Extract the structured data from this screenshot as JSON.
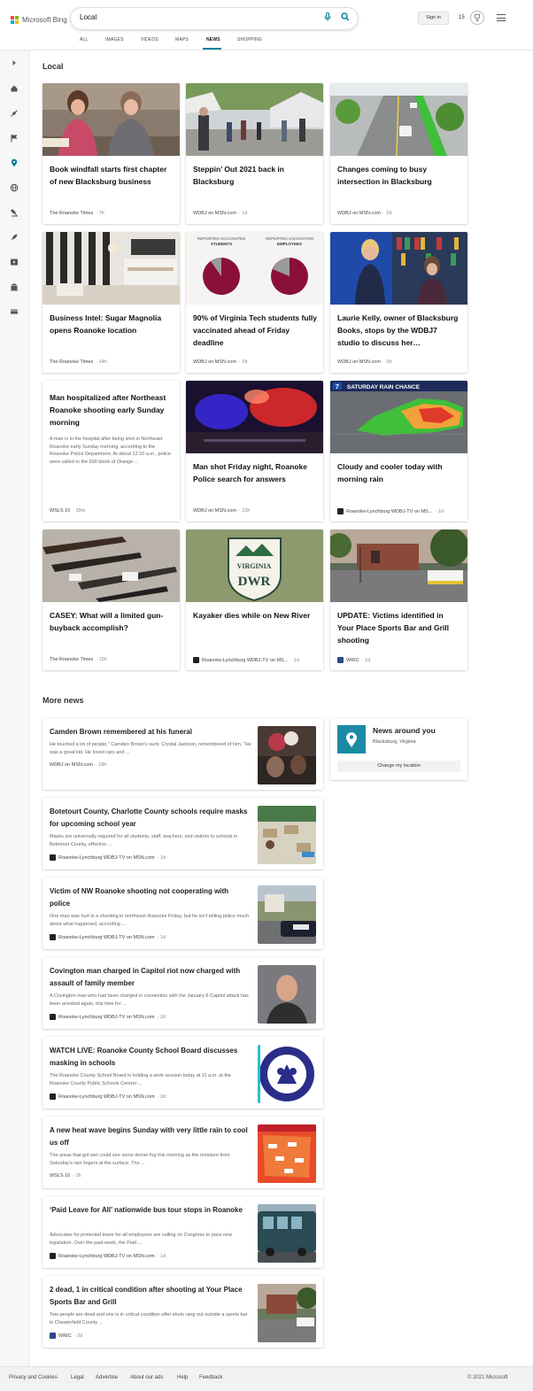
{
  "app": {
    "brand": "Microsoft Bing"
  },
  "search": {
    "query": "Local"
  },
  "header": {
    "signin_label": "Sign in",
    "rewards_count": "15"
  },
  "tabs": [
    {
      "label": "ALL"
    },
    {
      "label": "IMAGES"
    },
    {
      "label": "VIDEOS"
    },
    {
      "label": "MAPS"
    },
    {
      "label": "NEWS"
    },
    {
      "label": "SHOPPING"
    }
  ],
  "active_tab": "NEWS",
  "accent_color": "#00809d",
  "rail_icons": [
    "expand-chevron-icon",
    "home-icon",
    "satellite-icon",
    "flag-icon",
    "location-pin-icon",
    "globe-icon",
    "science-icon",
    "rocket-icon",
    "video-icon",
    "bank-icon",
    "money-icon"
  ],
  "local": {
    "title": "Local",
    "cards": [
      {
        "title": "Book windfall starts first chapter of new Blacksburg business",
        "source": "The Roanoke Times",
        "age": "7h"
      },
      {
        "title": "Steppin’ Out 2021 back in Blacksburg",
        "source": "WDBJ on MSN.com",
        "age": "1d"
      },
      {
        "title": "Changes coming to busy intersection in Blacksburg",
        "source": "WDBJ on MSN.com",
        "age": "2d"
      },
      {
        "title": "Business Intel: Sugar Magnolia opens Roanoke location",
        "source": "The Roanoke Times",
        "age": "14h"
      },
      {
        "title": "90% of Virginia Tech students fully vaccinated ahead of Friday deadline",
        "source": "WDBJ on MSN.com",
        "age": "2d",
        "image_labels": [
          "REPORTED VACCINATED STUDENTS",
          "REPORTED VACCINATED EMPLOYEES"
        ]
      },
      {
        "title": "Laurie Kelly, owner of Blacksburg Books, stops by the WDBJ7 studio to discuss her…",
        "source": "WDBJ on MSN.com",
        "age": "3d"
      },
      {
        "title": "Man hospitalized after Northeast Roanoke shooting early Sunday morning",
        "snippet": "A man is in the hospital after being shot in Northeast Roanoke early Sunday morning, according to the Roanoke Police Department. At about 12:10 a.m., police were called to the 600 block of Orange ...",
        "source": "WSLS 10",
        "age": "39m"
      },
      {
        "title": "Man shot Friday night, Roanoke Police search for answers",
        "source": "WDBJ on MSN.com",
        "age": "22h"
      },
      {
        "title": "Cloudy and cooler today with morning rain",
        "source": "Roanoke-Lynchburg WDBJ-TV on MS...",
        "age": "1d",
        "image_labels": [
          "7",
          "SATURDAY RAIN CHANCE"
        ]
      },
      {
        "title": "CASEY: What will a limited gun-buyback accomplish?",
        "source": "The Roanoke Times",
        "age": "15h"
      },
      {
        "title": "Kayaker dies while on New River",
        "source": "Roanoke-Lynchburg WDBJ-TV on MS...",
        "age": "1d",
        "image_labels": [
          "VIRGINIA",
          "DWR"
        ]
      },
      {
        "title": "UPDATE: Victims identified in Your Place Sports Bar and Grill shooting",
        "source": "WRIC",
        "age": "1d"
      }
    ]
  },
  "more_news": {
    "title": "More news",
    "items": [
      {
        "title": "Camden Brown remembered at his funeral",
        "snippet": "He touched a lot of people,\" Camden Brown's aunt, Crystal Jackson, remembered of him. \"He was a great kid. He loved cars and ...",
        "source": "WDBJ on MSN.com",
        "age": "18h"
      },
      {
        "title": "Botetourt County, Charlotte County schools require masks for upcoming school year",
        "snippet": "Masks are universally required for all students, staff, teachers, and visitors to schools in Botetourt County, effective ...",
        "source": "Roanoke-Lynchburg WDBJ-TV on MSN.com",
        "age": "1d"
      },
      {
        "title": "Victim of NW Roanoke shooting not cooperating with police",
        "snippet": "One man was hurt in a shooting in northwest Roanoke Friday, but he isn't telling police much about what happened. according ...",
        "source": "Roanoke-Lynchburg WDBJ-TV on MSN.com",
        "age": "1d"
      },
      {
        "title": "Covington man charged in Capitol riot now charged with assault of family member",
        "snippet": "A Covington man who had been charged in connection with the January 6 Capitol attack has been arrested again, this time for ...",
        "source": "Roanoke-Lynchburg WDBJ-TV on MSN.com",
        "age": "2d"
      },
      {
        "title": "WATCH LIVE: Roanoke County School Board discusses masking in schools",
        "snippet": "The Roanoke County School Board is holding a work session today at 11 a.m. at the Roanoke County Public Schools Central ...",
        "source": "Roanoke-Lynchburg WDBJ-TV on MSN.com",
        "age": "2d"
      },
      {
        "title": "A new heat wave begins Sunday with very little rain to cool us off",
        "snippet": "The areas that got wet could see some dense fog this morning as the moisture from Saturday's rain lingers at the surface. The ...",
        "source": "WSLS 10",
        "age": "3h"
      },
      {
        "title": "‘Paid Leave for All’ nationwide bus tour stops in Roanoke",
        "snippet": "Advocates for protected leave for all employees are calling on Congress to pass new legislation. Over the past week, the Paid ...",
        "source": "Roanoke-Lynchburg WDBJ-TV on MSN.com",
        "age": "1d"
      },
      {
        "title": "2 dead, 1 in critical condition after shooting at Your Place Sports Bar and Grill",
        "snippet": "Two people are dead and one is in critical condition after shots rang out outside a sports bar in Chesterfield County ...",
        "source": "WRIC",
        "age": "2d"
      }
    ]
  },
  "news_around_you": {
    "title": "News around you",
    "location": "Blacksburg, Virginia",
    "button_label": "Change my location"
  },
  "footer": {
    "links": [
      "Privacy and Cookies",
      "Legal",
      "Advertise",
      "About our ads",
      "Help",
      "Feedback"
    ],
    "copyright": "© 2021 Microsoft"
  }
}
